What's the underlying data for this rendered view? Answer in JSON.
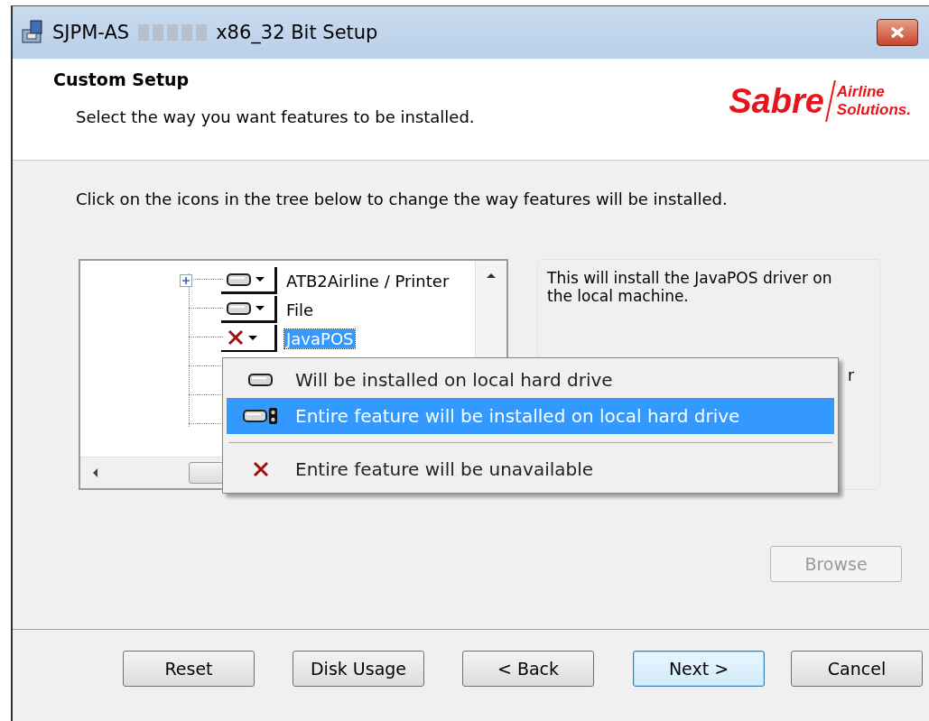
{
  "window": {
    "title_prefix": "SJPM-AS",
    "title_suffix": "x86_32 Bit Setup"
  },
  "header": {
    "title": "Custom Setup",
    "subtitle": "Select the way you want features to be installed.",
    "logo": {
      "brand": "Sabre",
      "line1": "Airline",
      "line2": "Solutions."
    }
  },
  "instruction": "Click on the icons in the tree below to change the way features will be installed.",
  "tree": {
    "items": [
      {
        "label": "ATB2Airline / Printer",
        "kind": "drive",
        "expandable": true,
        "selected": false
      },
      {
        "label": "File",
        "kind": "drive",
        "expandable": false,
        "selected": false
      },
      {
        "label": "JavaPOS",
        "kind": "unavailable",
        "expandable": false,
        "selected": true
      }
    ]
  },
  "description": {
    "text": "This will install the JavaPOS driver on the local machine.",
    "partial": "r"
  },
  "menu": {
    "items": [
      {
        "label": "Will be installed on local hard drive",
        "kind": "drive",
        "selected": false,
        "separator_before": false
      },
      {
        "label": "Entire feature will be installed on local hard drive",
        "kind": "drive-all",
        "selected": true,
        "separator_before": false
      },
      {
        "label": "Entire feature will be unavailable",
        "kind": "unavailable",
        "selected": false,
        "separator_before": true
      }
    ]
  },
  "browse": {
    "label": "Browse",
    "disabled": true
  },
  "buttons": [
    {
      "label": "Reset",
      "default": false
    },
    {
      "label": "Disk Usage",
      "default": false
    },
    {
      "label": "< Back",
      "default": false
    },
    {
      "label": "Next >",
      "default": true
    },
    {
      "label": "Cancel",
      "default": false
    }
  ]
}
